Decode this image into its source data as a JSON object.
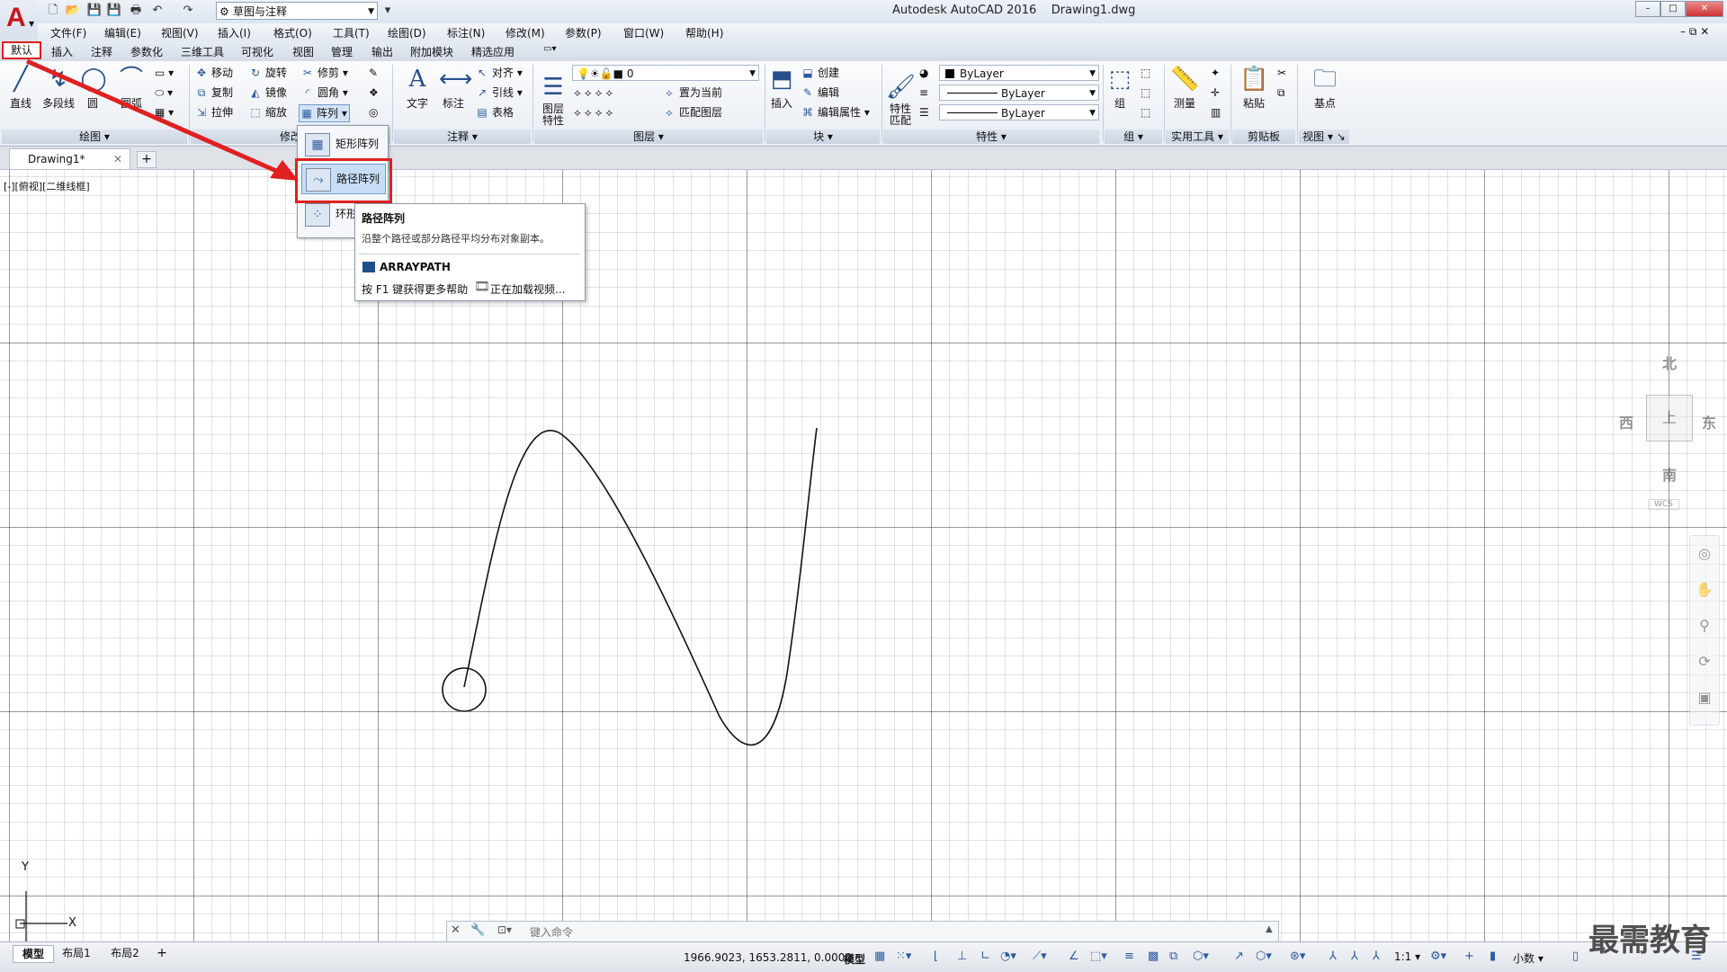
{
  "titlebar": {
    "workspace": "草图与注释",
    "title": "Autodesk AutoCAD 2016    Drawing1.dwg",
    "window_buttons": [
      "–",
      "□",
      "✕"
    ]
  },
  "menubar": {
    "items": [
      "文件(F)",
      "编辑(E)",
      "视图(V)",
      "插入(I)",
      "格式(O)",
      "工具(T)",
      "绘图(D)",
      "标注(N)",
      "修改(M)",
      "参数(P)",
      "窗口(W)",
      "帮助(H)"
    ],
    "doc_controls": "– ⧉ ✕"
  },
  "ribbon_tabs": {
    "items": [
      "默认",
      "插入",
      "注释",
      "参数化",
      "三维工具",
      "可视化",
      "视图",
      "管理",
      "输出",
      "附加模块",
      "精选应用"
    ]
  },
  "ribbon": {
    "draw": {
      "title": "绘图",
      "line": "直线",
      "polyline": "多段线",
      "circle": "圆",
      "arc": "圆弧"
    },
    "modify": {
      "title": "修改",
      "move": "移动",
      "rotate": "旋转",
      "trim": "修剪",
      "copy": "复制",
      "mirror": "镜像",
      "fillet": "圆角",
      "stretch": "拉伸",
      "scale": "缩放",
      "array": "阵列"
    },
    "annotation": {
      "title": "注释",
      "text": "文字",
      "dimension": "标注",
      "align": "对齐",
      "leader": "引线",
      "table": "表格"
    },
    "layers": {
      "title": "图层",
      "properties": "图层\n特性",
      "current_layer": "0",
      "set_current": "置为当前",
      "match_layer": "匹配图层"
    },
    "block": {
      "title": "块",
      "insert": "插入",
      "create": "创建",
      "edit": "编辑",
      "edit_attr": "编辑属性"
    },
    "properties": {
      "title": "特性",
      "match": "特性\n匹配",
      "color": "ByLayer",
      "linetype": "ByLayer",
      "lineweight": "ByLayer"
    },
    "groups": {
      "title": "组",
      "group": "组"
    },
    "utilities": {
      "title": "实用工具",
      "measure": "测量"
    },
    "clipboard": {
      "title": "剪贴板",
      "paste": "粘贴"
    },
    "view": {
      "title": "视图",
      "base": "基点"
    }
  },
  "array_dropdown": {
    "items": [
      "矩形阵列",
      "路径阵列",
      "环形阵列"
    ]
  },
  "tooltip": {
    "title": "路径阵列",
    "description": "沿整个路径或部分路径平均分布对象副本。",
    "command": "ARRAYPATH",
    "help": "按 F1 键获得更多帮助",
    "video": "正在加载视频..."
  },
  "document": {
    "tab": "Drawing1*",
    "viewport_label": "[-][俯视][二维线框]"
  },
  "viewcube": {
    "north": "北",
    "south": "南",
    "east": "东",
    "west": "西",
    "top": "上",
    "wcs": "WCS"
  },
  "ucs": {
    "x": "X",
    "y": "Y"
  },
  "command_line": {
    "placeholder": "键入命令"
  },
  "status": {
    "layout_tabs": [
      "模型",
      "布局1",
      "布局2"
    ],
    "coordinates": "1966.9023, 1653.2811, 0.0000",
    "mode": "模型",
    "scale": "1:1",
    "units": "小数"
  },
  "watermark": "最需教育",
  "colors": {
    "accent_red": "#e02020",
    "logo_red": "#c6161d",
    "grid": "#000000"
  }
}
